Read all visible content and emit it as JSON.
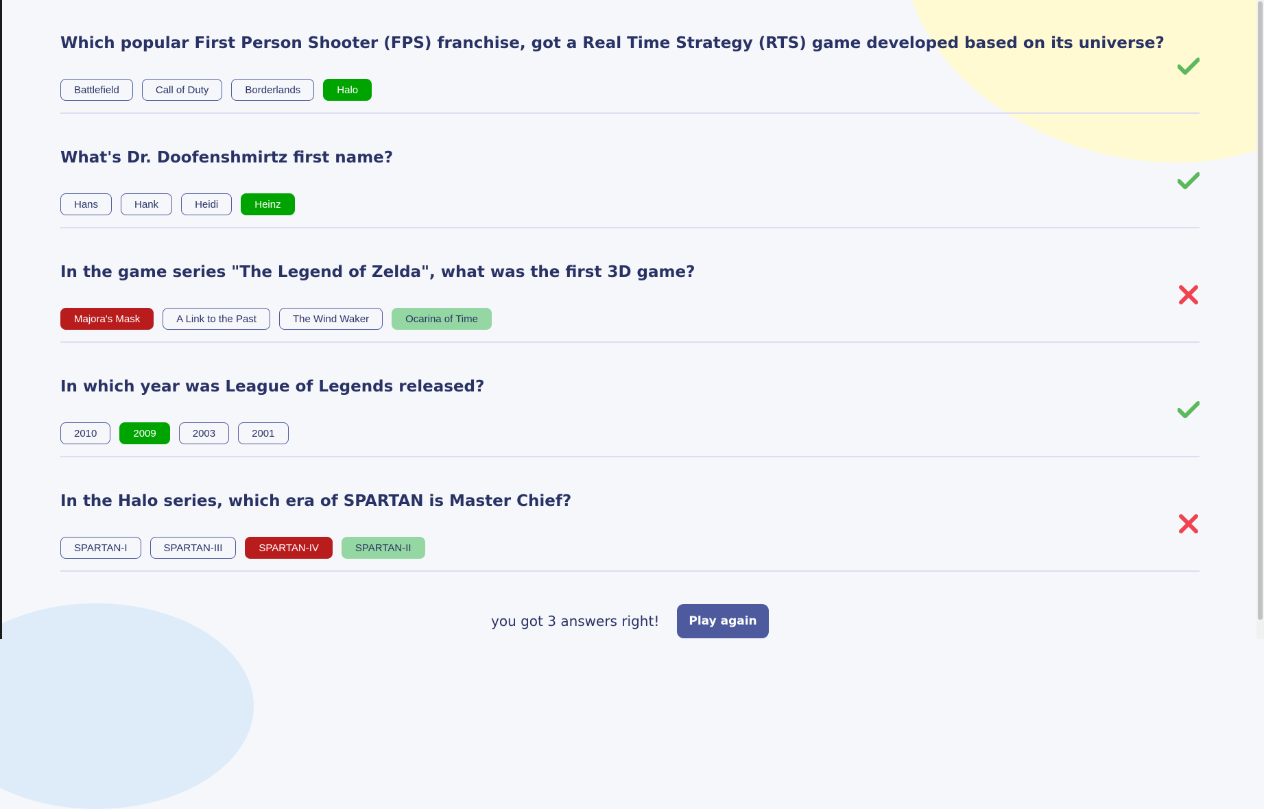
{
  "questions": [
    {
      "text": "Which popular First Person Shooter (FPS) franchise, got a Real Time Strategy (RTS) game developed based on its universe?",
      "result": "correct",
      "answers": [
        {
          "label": "Battlefield",
          "state": "neutral"
        },
        {
          "label": "Call of Duty",
          "state": "neutral"
        },
        {
          "label": "Borderlands",
          "state": "neutral"
        },
        {
          "label": "Halo",
          "state": "correct-chosen"
        }
      ]
    },
    {
      "text": "What's Dr. Doofenshmirtz first name?",
      "result": "correct",
      "answers": [
        {
          "label": "Hans",
          "state": "neutral"
        },
        {
          "label": "Hank",
          "state": "neutral"
        },
        {
          "label": "Heidi",
          "state": "neutral"
        },
        {
          "label": "Heinz",
          "state": "correct-chosen"
        }
      ]
    },
    {
      "text": "In the game series \"The Legend of Zelda\", what was the first 3D game?",
      "result": "wrong",
      "answers": [
        {
          "label": "Majora's Mask",
          "state": "wrong-chosen"
        },
        {
          "label": "A Link to the Past",
          "state": "neutral"
        },
        {
          "label": "The Wind Waker",
          "state": "neutral"
        },
        {
          "label": "Ocarina of Time",
          "state": "correct-shown"
        }
      ]
    },
    {
      "text": "In which year was League of Legends released?",
      "result": "correct",
      "answers": [
        {
          "label": "2010",
          "state": "neutral"
        },
        {
          "label": "2009",
          "state": "correct-chosen"
        },
        {
          "label": "2003",
          "state": "neutral"
        },
        {
          "label": "2001",
          "state": "neutral"
        }
      ]
    },
    {
      "text": "In the Halo series, which era of SPARTAN is Master Chief?",
      "result": "wrong",
      "answers": [
        {
          "label": "SPARTAN-I",
          "state": "neutral"
        },
        {
          "label": "SPARTAN-III",
          "state": "neutral"
        },
        {
          "label": "SPARTAN-IV",
          "state": "wrong-chosen"
        },
        {
          "label": "SPARTAN-II",
          "state": "correct-shown"
        }
      ]
    }
  ],
  "footer": {
    "score_text": "you got 3 answers right!",
    "play_again_label": "Play again"
  },
  "icons": {
    "correct": "check-icon",
    "wrong": "cross-icon"
  },
  "colors": {
    "background": "#F5F7FB",
    "text": "#293264",
    "correct_chosen": "#00A400",
    "wrong_chosen": "#B91C1C",
    "correct_shown": "#94D7A2",
    "check_icon": "#5CB85C",
    "cross_icon": "#F0434F",
    "button": "#4D5B9E"
  }
}
